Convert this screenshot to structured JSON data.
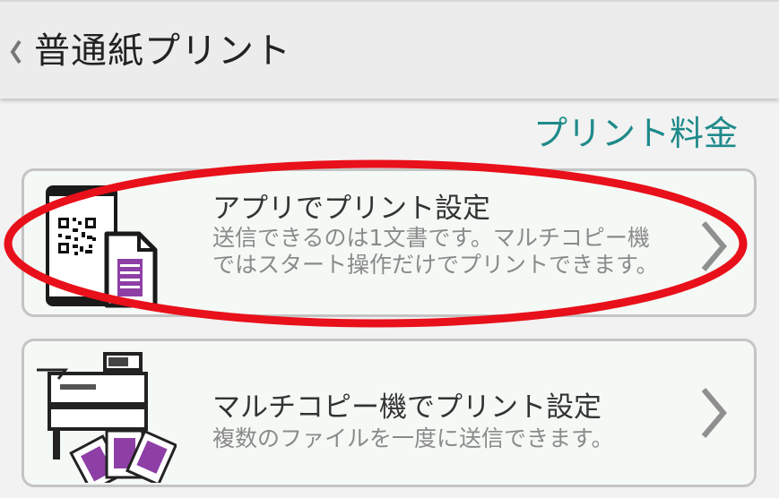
{
  "header": {
    "title": "普通紙プリント",
    "back_icon": "chevron-left-icon"
  },
  "price_link": "プリント料金",
  "cards": [
    {
      "title": "アプリでプリント設定",
      "description": "送信できるのは1文書です。マルチコピー機ではスタート操作だけでプリントできます。",
      "icon": "qr-phone-document-icon"
    },
    {
      "title": "マルチコピー機でプリント設定",
      "description": "複数のファイルを一度に送信できます。",
      "icon": "copier-documents-icon"
    }
  ],
  "colors": {
    "accent_teal": "#1f8a8a",
    "document_purple": "#8e3fa6",
    "highlight_red": "#e8101a"
  }
}
